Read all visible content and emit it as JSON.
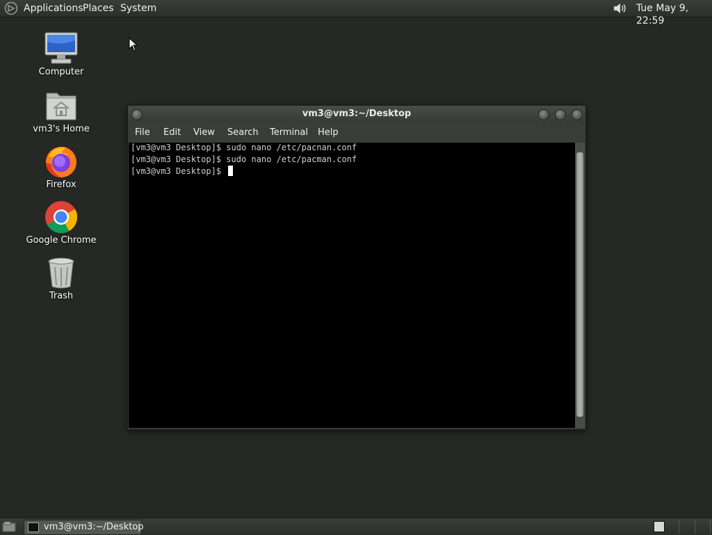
{
  "top_panel": {
    "menus": [
      "Applications",
      "Places",
      "System"
    ],
    "clock": "Tue May  9, 22:59",
    "icons": {
      "logo": "gnome-foot-icon",
      "sound": "speaker-volume-icon"
    }
  },
  "desktop": {
    "icons": [
      {
        "label": "Computer",
        "icon": "computer-monitor-icon"
      },
      {
        "label": "vm3's Home",
        "icon": "home-folder-icon"
      },
      {
        "label": "Firefox",
        "icon": "firefox-icon"
      },
      {
        "label": "Google Chrome",
        "icon": "chrome-icon"
      },
      {
        "label": "Trash",
        "icon": "trash-icon"
      }
    ]
  },
  "terminal": {
    "title": "vm3@vm3:~/Desktop",
    "menu": [
      "File",
      "Edit",
      "View",
      "Search",
      "Terminal",
      "Help"
    ],
    "lines": [
      "[vm3@vm3 Desktop]$ sudo nano /etc/pacnan.conf",
      "[vm3@vm3 Desktop]$ sudo nano /etc/pacman.conf",
      "[vm3@vm3 Desktop]$ "
    ]
  },
  "taskbar": {
    "window_label": "vm3@vm3:~/Desktop",
    "icons": {
      "show_desktop": "show-desktop-icon",
      "task": "terminal-icon"
    }
  },
  "colors": {
    "desktop_bg": "#262825",
    "panel_bg": "#2c2e2b",
    "terminal_bg": "#000000",
    "terminal_text": "#d0d0d0"
  }
}
